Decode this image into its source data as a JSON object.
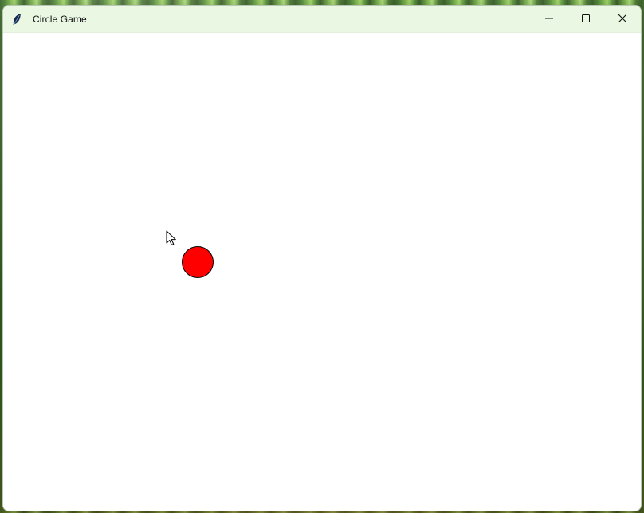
{
  "window": {
    "title": "Circle Game",
    "background_color": "#ffffff",
    "titlebar_color": "#eaf8e3"
  },
  "icons": {
    "app": "feather-icon",
    "minimize": "minimize-icon",
    "maximize": "maximize-icon",
    "close": "close-icon",
    "cursor": "mouse-pointer-icon"
  },
  "game": {
    "circle_color": "#ff0000",
    "circle_outline": "#000000"
  }
}
